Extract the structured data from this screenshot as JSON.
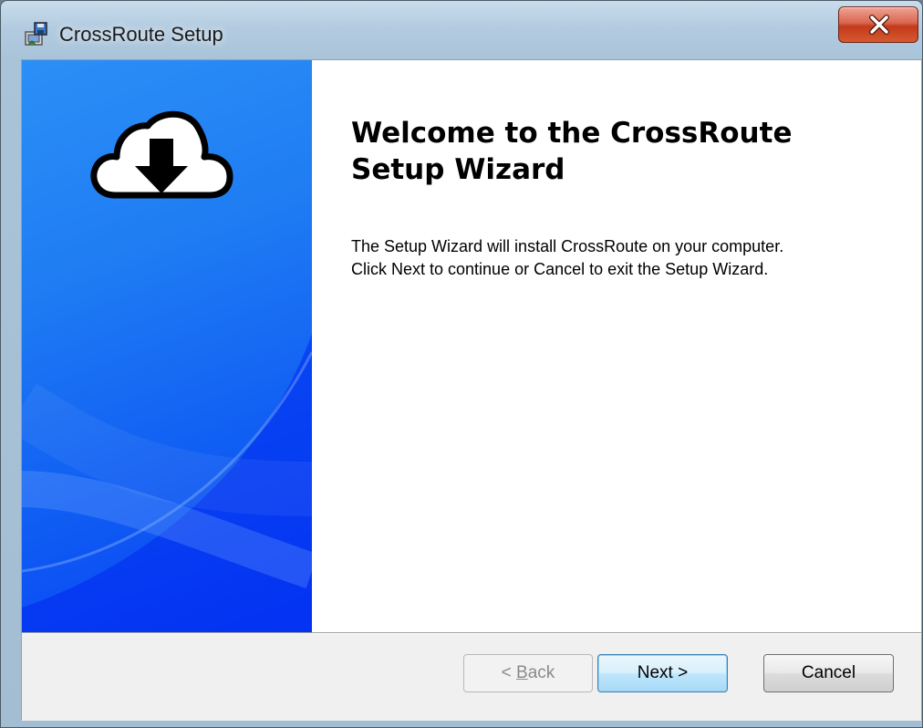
{
  "window": {
    "title": "CrossRoute Setup",
    "close_glyph": "x"
  },
  "icons": {
    "app": "installer-icon",
    "close": "close-icon",
    "banner": "cloud-download-icon"
  },
  "content": {
    "heading": "Welcome to the CrossRoute Setup Wizard",
    "description_line1": "The Setup Wizard will install CrossRoute on your computer.",
    "description_line2": "Click Next to continue or Cancel to exit the Setup Wizard."
  },
  "buttons": {
    "back_prefix": "< ",
    "back_mnemonic": "B",
    "back_rest": "ack",
    "next": "Next >",
    "cancel": "Cancel",
    "back_enabled": false
  },
  "colors": {
    "banner_top": "#2b8ff6",
    "banner_bottom": "#0a3ff5",
    "close_red": "#c23a1c"
  }
}
